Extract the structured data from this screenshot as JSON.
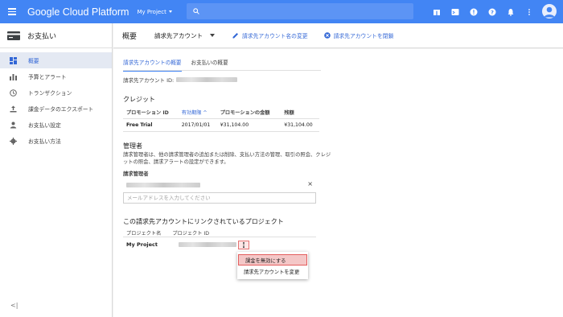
{
  "topbar": {
    "brand": "Google Cloud Platform",
    "project": "My Project",
    "search_placeholder": "",
    "color": "#4285f4",
    "icons": [
      "gift-icon",
      "terminal-icon",
      "alert-icon",
      "help-icon",
      "bell-icon",
      "more-vert-icon"
    ]
  },
  "sidebar": {
    "title": "お支払い",
    "items": [
      {
        "label": "概要",
        "icon": "dashboard-icon",
        "active": true
      },
      {
        "label": "予算とアラート",
        "icon": "budget-icon"
      },
      {
        "label": "トランザクション",
        "icon": "clock-icon"
      },
      {
        "label": "課金データのエクスポート",
        "icon": "export-icon"
      },
      {
        "label": "お支払い設定",
        "icon": "person-icon"
      },
      {
        "label": "お支払い方法",
        "icon": "gear-icon"
      }
    ],
    "collapse_label": "<|"
  },
  "header": {
    "title": "概要",
    "account_select": "請求先アカウント",
    "rename_label": "請求先アカウント名の変更",
    "close_label": "請求先アカウントを閉鎖"
  },
  "tabs": [
    {
      "label": "請求先アカウントの概要",
      "active": true
    },
    {
      "label": "お支払いの概要"
    }
  ],
  "account": {
    "id_label": "請求先アカウント ID:"
  },
  "credit": {
    "title": "クレジット",
    "columns": [
      "プロモーション ID",
      "有効期限 ^",
      "プロモーションの金額",
      "残額"
    ],
    "rows": [
      [
        "Free Trial",
        "2017/01/01",
        "¥31,104.00",
        "¥31,104.00"
      ]
    ]
  },
  "admins": {
    "title": "管理者",
    "description": "請求管理者は、他の請求管理者の追加または削除、支払い方法の管理、取引の照会、クレジットの照会、請求アラートの設定ができます。",
    "label": "請求管理者",
    "remove_label": "×",
    "input_placeholder": "メールアドレスを入力してください"
  },
  "projects": {
    "title": "この請求先アカウントにリンクされているプロジェクト",
    "columns": [
      "プロジェクト名",
      "プロジェクト ID"
    ],
    "rows": [
      {
        "name": "My Project"
      }
    ],
    "menu": [
      "課金を無効にする",
      "請求先アカウントを変更"
    ]
  }
}
